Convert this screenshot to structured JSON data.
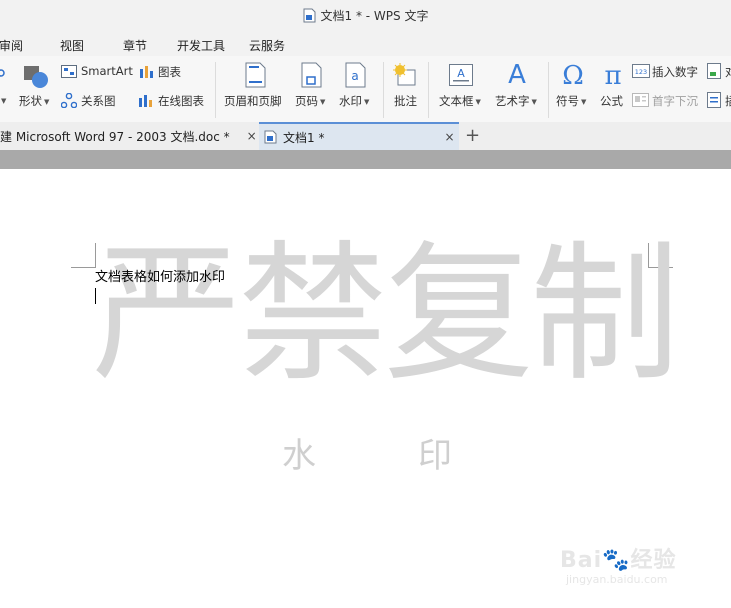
{
  "window": {
    "title": "文档1 * - WPS 文字"
  },
  "menu": {
    "tabs": [
      "审阅",
      "视图",
      "章节",
      "开发工具",
      "云服务"
    ]
  },
  "ribbon": {
    "shape_label": "形状",
    "smartart_label": "SmartArt",
    "chart_label": "图表",
    "relation_label": "关系图",
    "online_chart_label": "在线图表",
    "header_footer_label": "页眉和页脚",
    "page_num_label": "页码",
    "watermark_label": "水印",
    "comment_label": "批注",
    "textbox_label": "文本框",
    "wordart_label": "艺术字",
    "symbol_label": "符号",
    "formula_label": "公式",
    "insert_number_label": "插入数字",
    "dropcap_label": "首字下沉",
    "insert_number_badge": "123"
  },
  "doc_tabs": {
    "tab1": "建 Microsoft Word 97 - 2003 文档.doc *",
    "tab2": "文档1 *",
    "close_glyph": "×",
    "new_tab_glyph": "+"
  },
  "document": {
    "body_text": "文档表格如何添加水印",
    "watermark_text": "严禁复制",
    "watermark_small_1": "水",
    "watermark_small_2": "印"
  },
  "brand": {
    "logo_text": "Bai🐾经验",
    "url": "jingyan.baidu.com"
  },
  "colors": {
    "accent_blue": "#2f6fcb",
    "active_tab": "#dde6f0",
    "watermark_gray": "#d6d6d6"
  }
}
